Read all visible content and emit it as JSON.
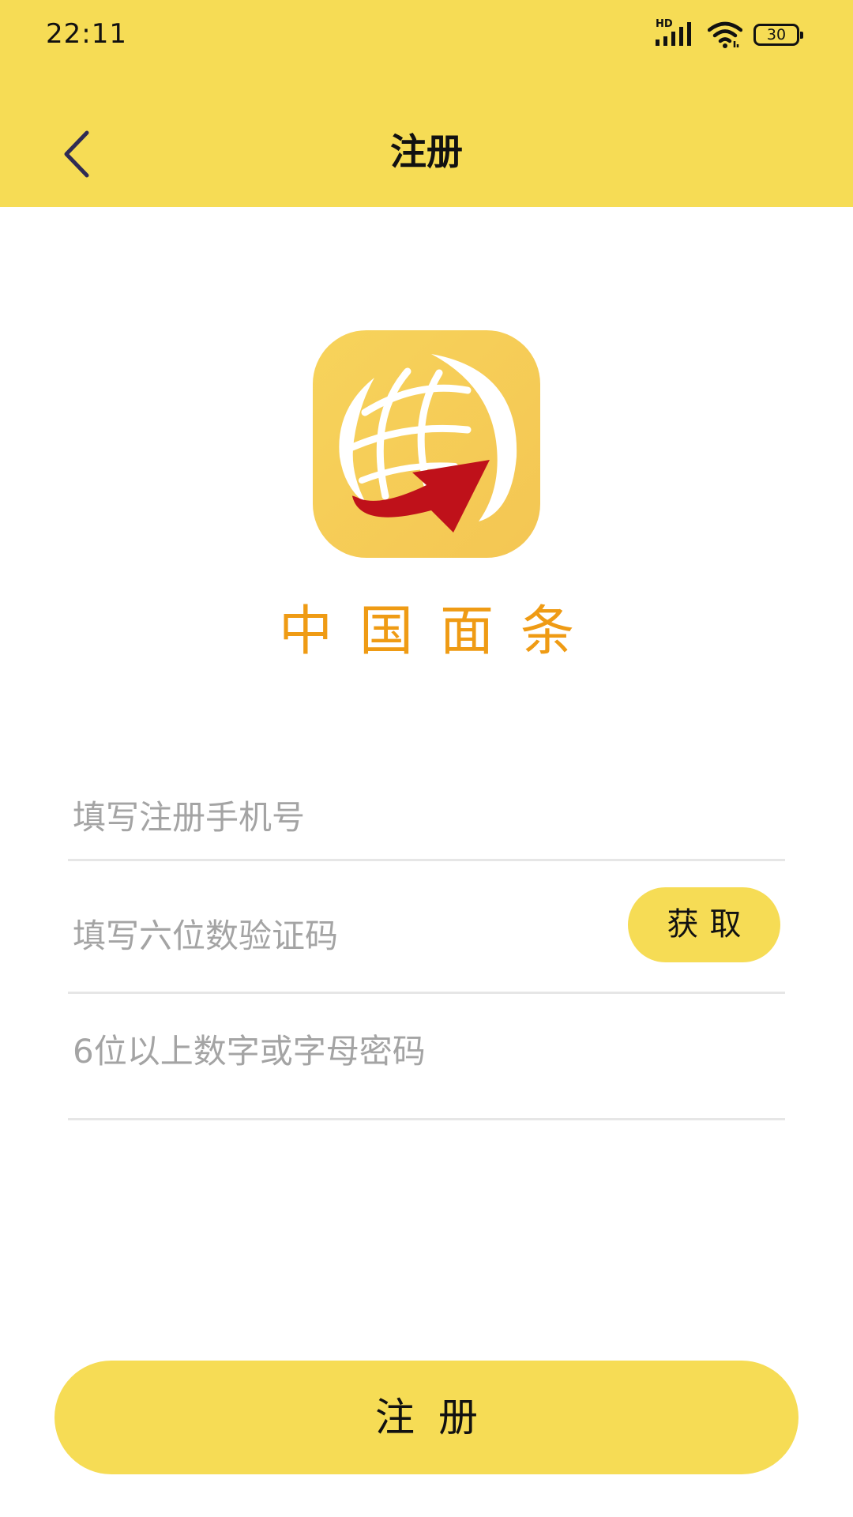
{
  "status_bar": {
    "time": "22:11",
    "network_label": "HD",
    "battery": "30",
    "icons": [
      "signal-icon",
      "wifi-icon",
      "battery-icon"
    ]
  },
  "header": {
    "title": "注册",
    "back_icon": "chevron-left-icon"
  },
  "brand": {
    "name": "中国面条",
    "logo_icon": "globe-arrow-logo"
  },
  "form": {
    "phone_placeholder": "填写注册手机号",
    "code_placeholder": "填写六位数验证码",
    "get_code_label": "获取",
    "password_placeholder": "6位以上数字或字母密码"
  },
  "actions": {
    "register_label": "注册"
  },
  "colors": {
    "accent": "#f6dc55",
    "brand_text": "#ef9b14",
    "logo_arrow": "#bf111a",
    "placeholder": "#a4a4a4",
    "divider": "#e6e6e6"
  }
}
